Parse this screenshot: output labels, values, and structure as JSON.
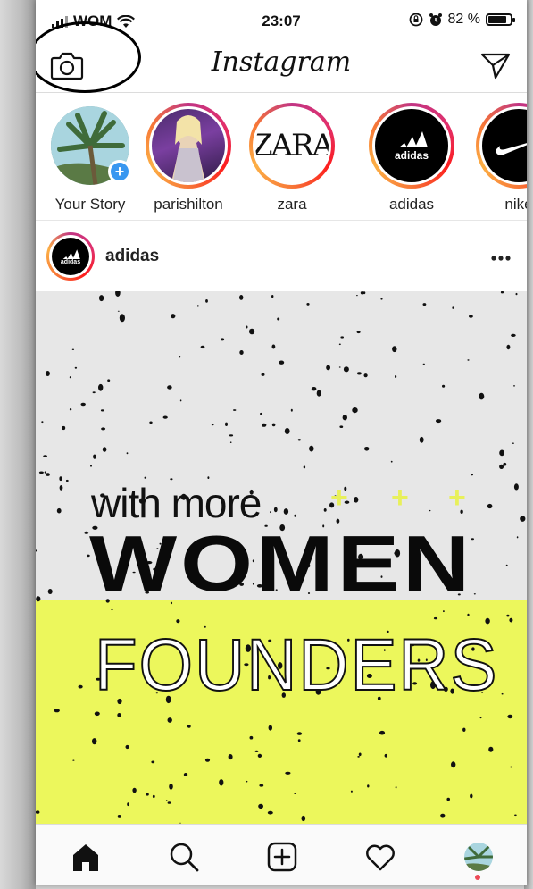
{
  "status_bar": {
    "carrier": "WOM",
    "time": "23:07",
    "battery": "82 %"
  },
  "header": {
    "title": "Instagram",
    "icons": [
      "camera-icon",
      "direct-message-icon"
    ]
  },
  "stories": [
    {
      "username": "Your Story",
      "own": true
    },
    {
      "username": "parishilton"
    },
    {
      "username": "zara",
      "logo_text": "ZARA"
    },
    {
      "username": "adidas",
      "logo_text": "adidas"
    },
    {
      "username": "nike"
    }
  ],
  "post": {
    "username": "adidas",
    "avatar_logo_text": "adidas",
    "image_text": {
      "line1": "with more",
      "line2": "WOMEN",
      "line3": "FOUNDERS"
    }
  },
  "tab_bar": {
    "items": [
      "home-icon",
      "search-icon",
      "new-post-icon",
      "activity-icon",
      "profile-icon"
    ]
  },
  "colors": {
    "story_ring": "#e1306c",
    "add_story_badge": "#3897f0",
    "post_yellow": "#ecf75c",
    "post_grey": "#e7e7e7",
    "notification_dot": "#ed4956"
  }
}
